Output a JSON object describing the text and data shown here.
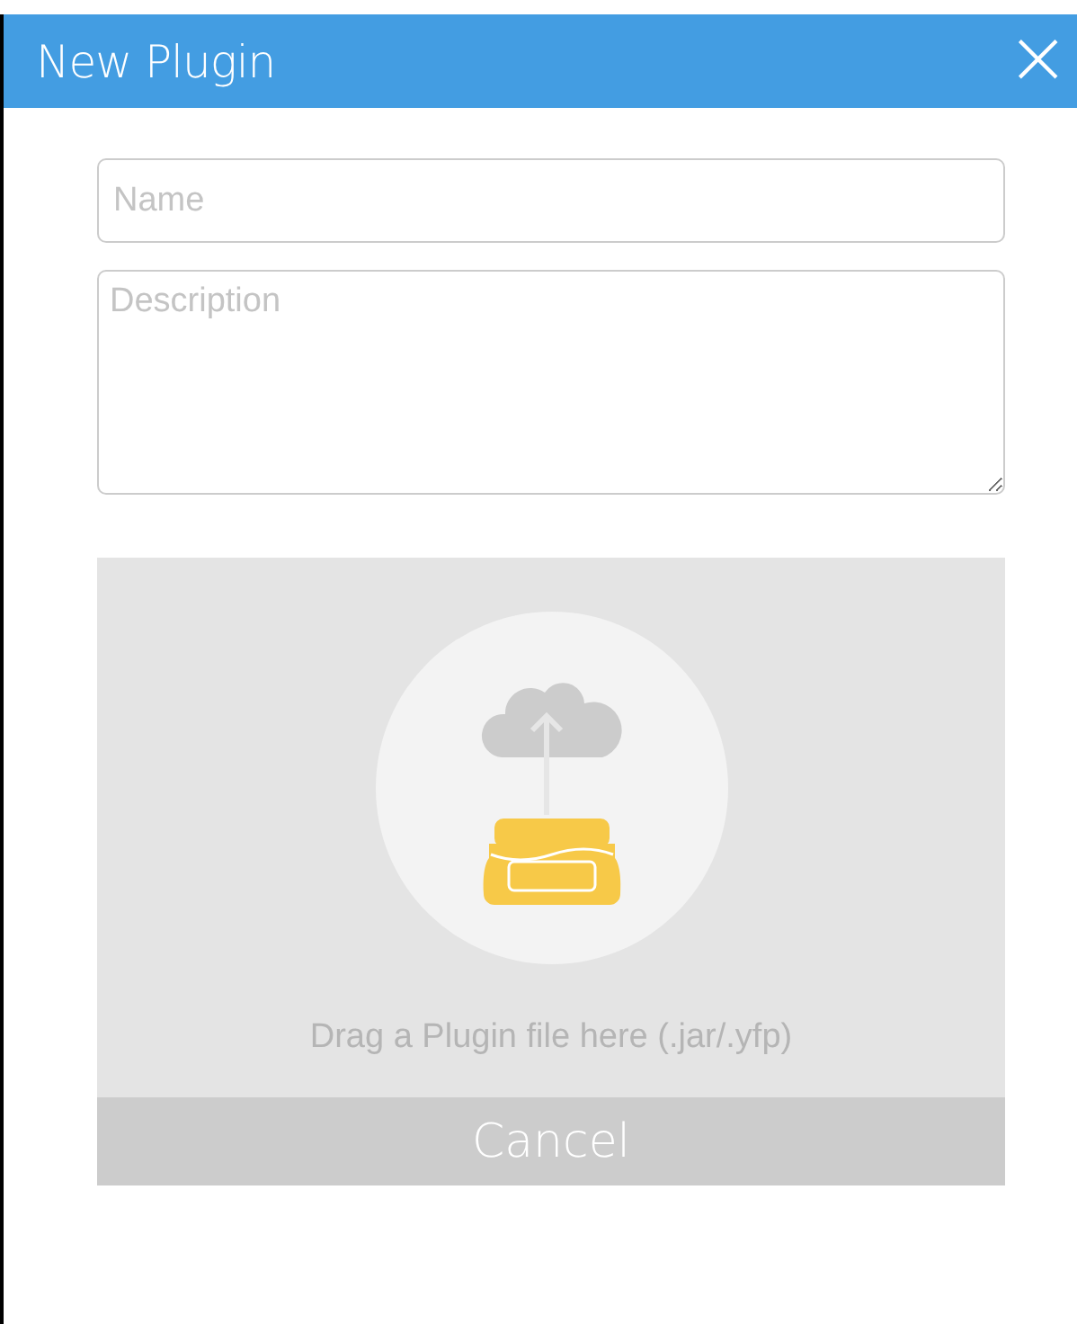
{
  "dialog": {
    "title": "New Plugin",
    "close_icon": "×"
  },
  "fields": [
    {
      "kind": "input",
      "placeholder": "Name"
    },
    {
      "kind": "textarea",
      "placeholder": "Description"
    }
  ],
  "dropzone": {
    "hint": "Drag a Plugin file here (.jar/.yfp)"
  },
  "buttons": [
    "Cancel"
  ]
}
